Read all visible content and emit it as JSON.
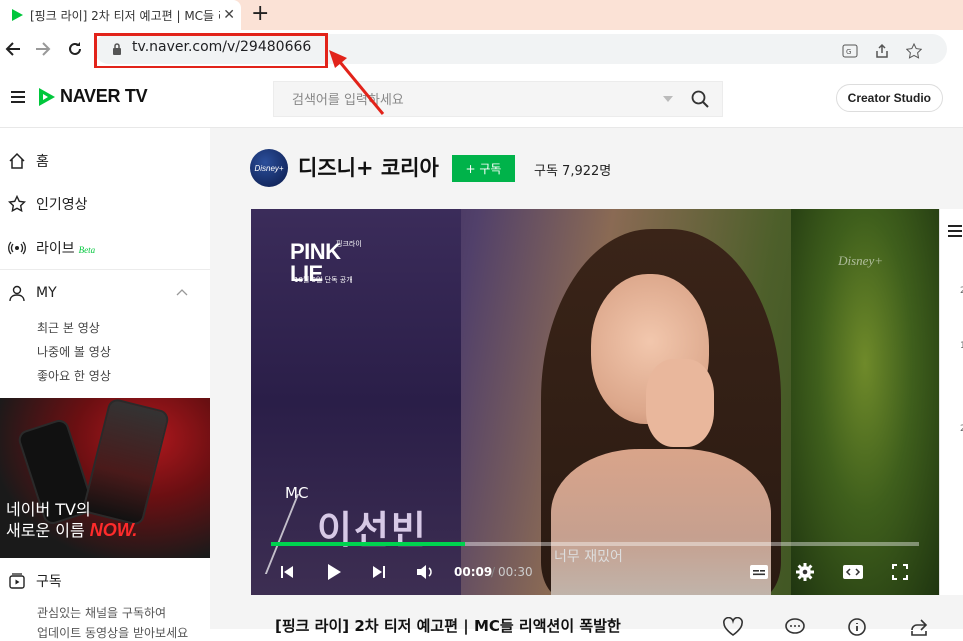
{
  "browser": {
    "tab_title": "[핑크 라이] 2차 티저 예고편 | MC들 리액션이 폭발한",
    "url": "tv.naver.com/v/29480666"
  },
  "header": {
    "logo_text": "NAVER TV",
    "search_placeholder": "검색어를 입력하세요",
    "creator_studio": "Creator Studio"
  },
  "sidebar": {
    "home": "홈",
    "popular": "인기영상",
    "live": "라이브",
    "live_badge": "Beta",
    "my": "MY",
    "my_items": [
      "최근 본 영상",
      "나중에 볼 영상",
      "좋아요 한 영상"
    ],
    "promo_line1": "네이버 TV의",
    "promo_line2": "새로운 이름",
    "promo_brand": "NOW.",
    "subscriptions": "구독",
    "sub_desc1": "관심있는 채널을 구독하여",
    "sub_desc2": "업데이트 동영상을 받아보세요"
  },
  "channel": {
    "logo_text": "Disney+",
    "name": "디즈니+ 코리아",
    "subscribe_label": "+ 구독",
    "subscriber_count": "구독 7,922명"
  },
  "video": {
    "show_logo": "PINK LIE",
    "show_logo_kor": "핑크라이",
    "show_sub": "10월 5일 단독 공개",
    "watermark": "Disney+",
    "mc_label": "MC",
    "mc_name": "이선빈",
    "caption": "너무 재밌어",
    "current_time": "00:09",
    "separator": "/",
    "total_time": "00:30",
    "progress_fraction": 0.3,
    "title": "[핑크 라이] 2차 티저 예고편 | MC들 리액션이 폭발한"
  },
  "right_panel": {
    "numbers": [
      "2",
      "1",
      "2"
    ]
  },
  "colors": {
    "accent_green": "#00c73c",
    "highlight_red": "#e2231a"
  }
}
